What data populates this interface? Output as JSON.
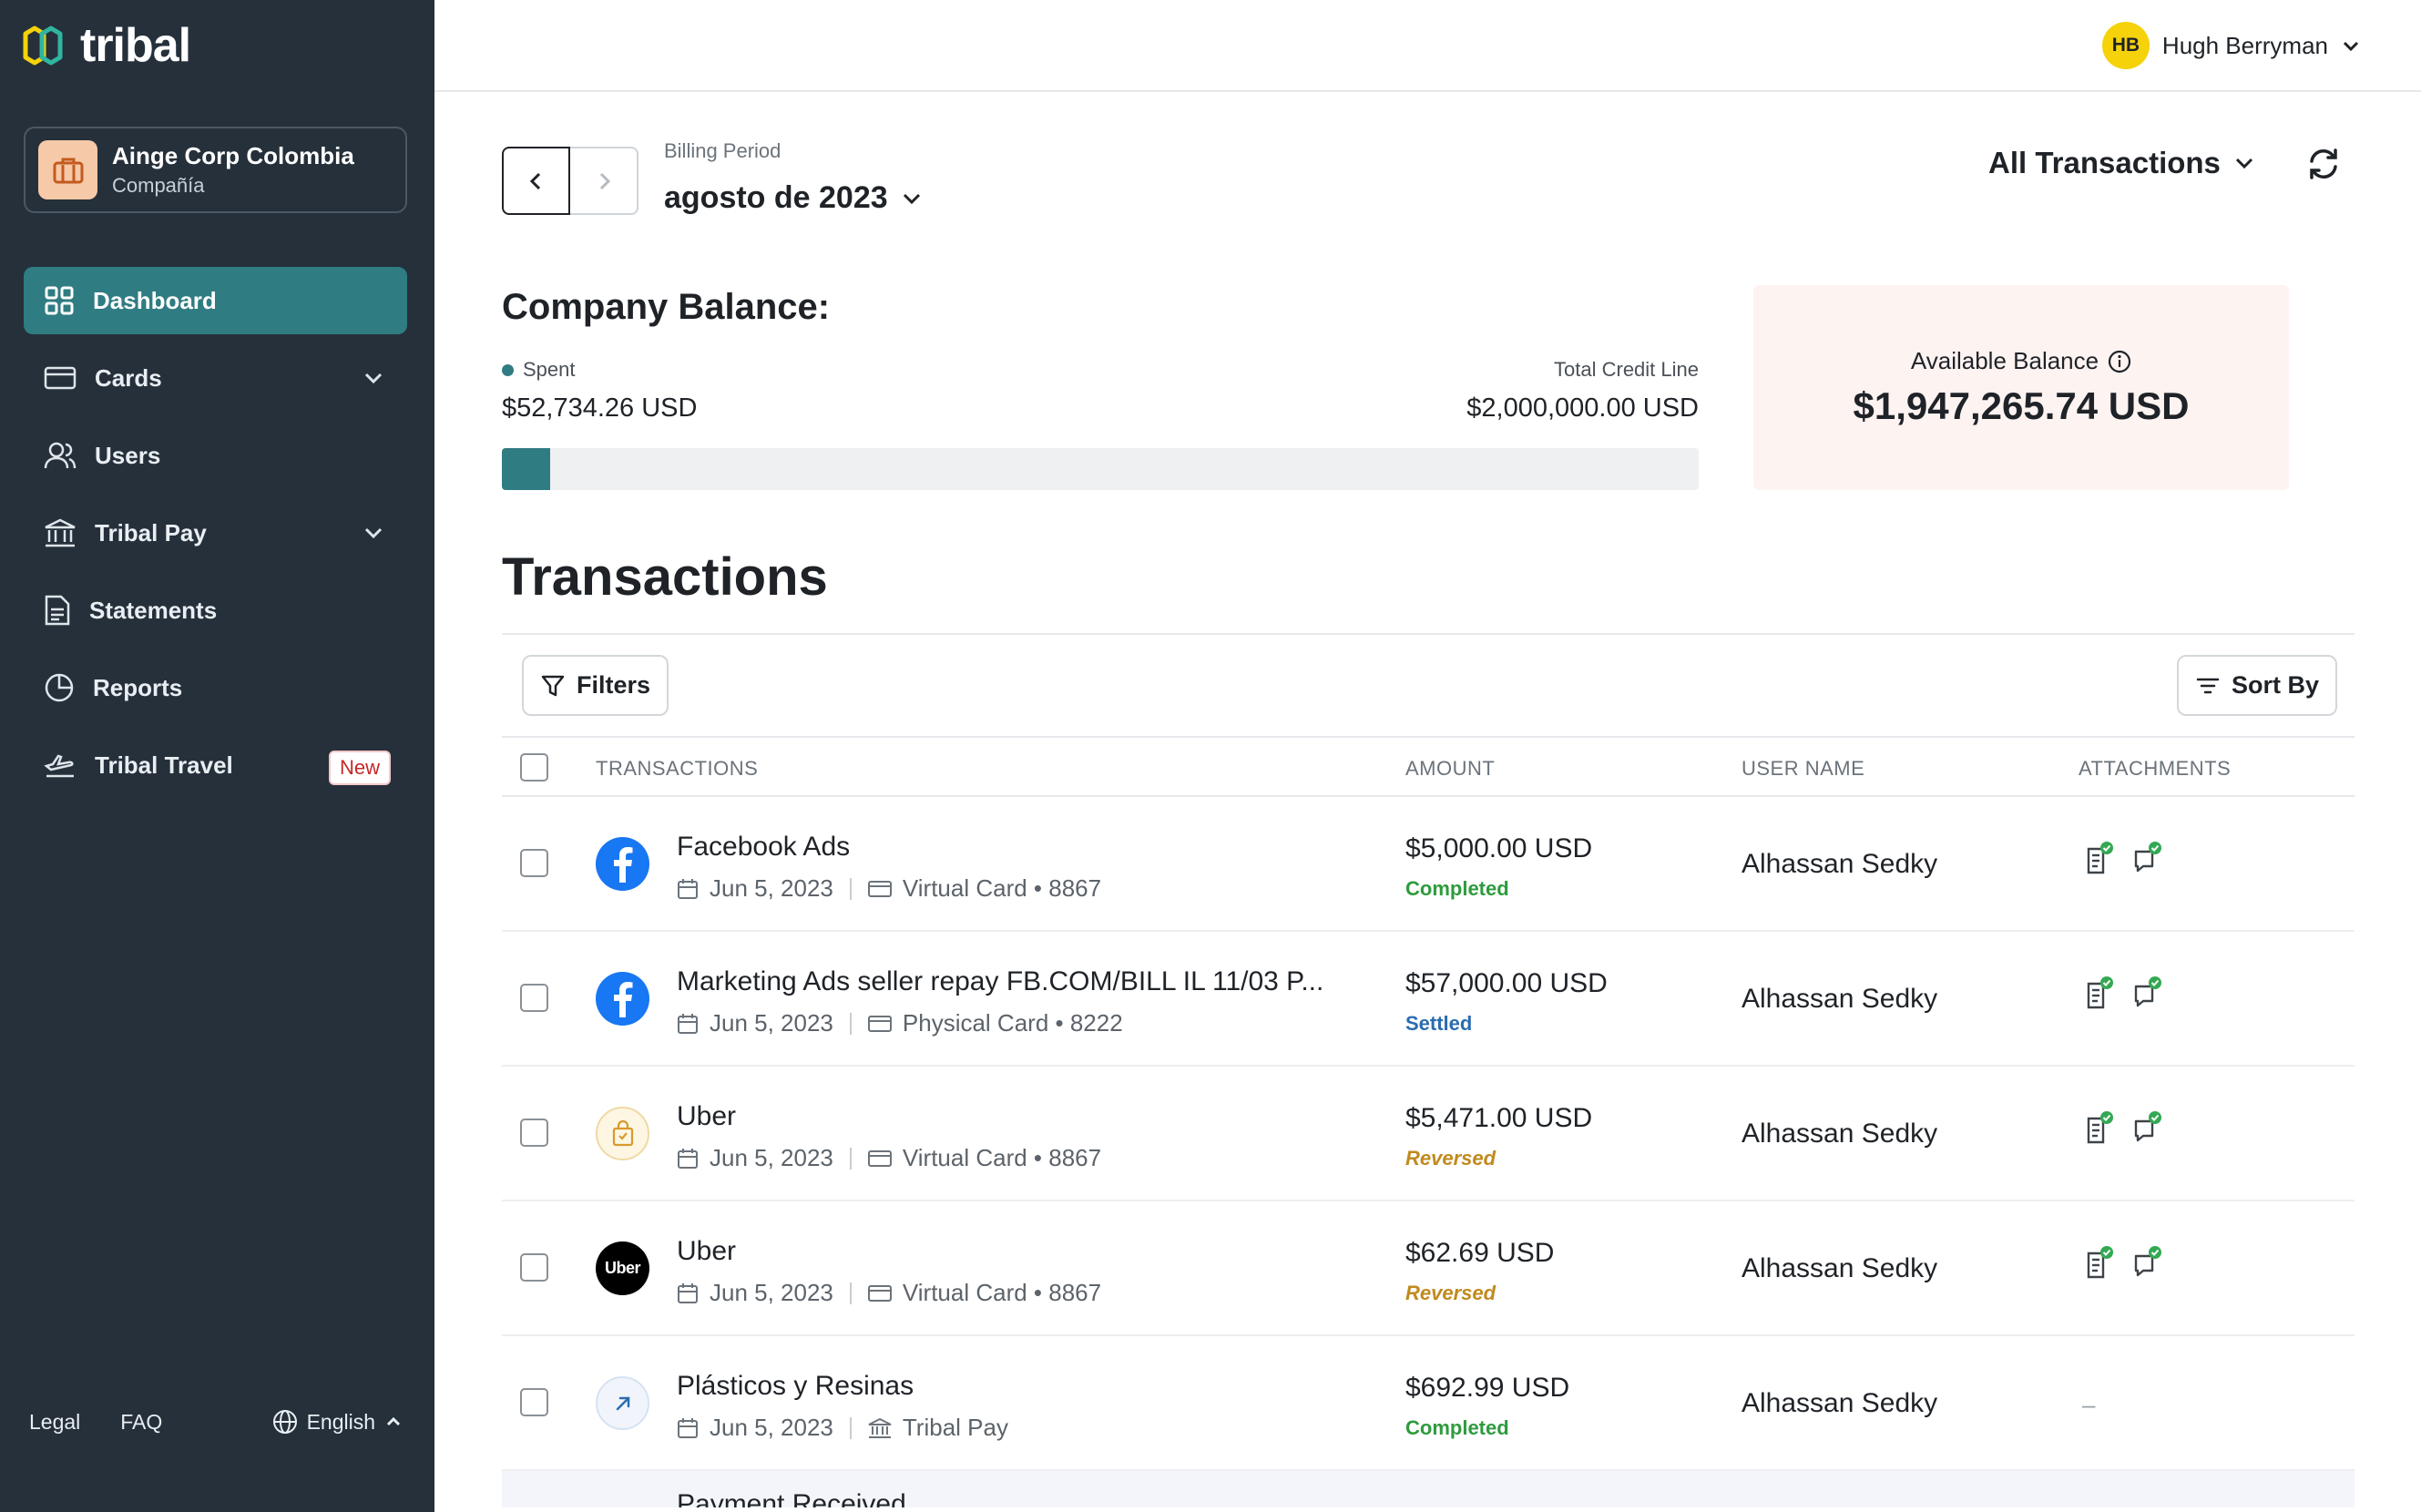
{
  "brand": {
    "name": "tribal"
  },
  "company": {
    "name": "Ainge Corp Colombia",
    "type": "Compañía"
  },
  "nav": [
    {
      "label": "Dashboard",
      "icon": "grid-icon"
    },
    {
      "label": "Cards",
      "icon": "card-icon"
    },
    {
      "label": "Users",
      "icon": "users-icon"
    },
    {
      "label": "Tribal Pay",
      "icon": "bank-icon"
    },
    {
      "label": "Statements",
      "icon": "document-icon"
    },
    {
      "label": "Reports",
      "icon": "pie-chart-icon"
    },
    {
      "label": "Tribal Travel",
      "icon": "plane-icon",
      "badge": "New"
    }
  ],
  "footer": {
    "legal": "Legal",
    "faq": "FAQ",
    "language": "English"
  },
  "user": {
    "initials": "HB",
    "name": "Hugh Berryman"
  },
  "billing": {
    "label": "Billing Period",
    "value": "agosto de 2023"
  },
  "view_filter": "All Transactions",
  "balance": {
    "title": "Company Balance:",
    "spent_label": "Spent",
    "spent_value": "$52,734.26 USD",
    "credit_label": "Total Credit Line",
    "credit_value": "$2,000,000.00 USD",
    "spent_fraction": 0.0264,
    "available_label": "Available Balance",
    "available_value": "$1,947,265.74 USD"
  },
  "transactions": {
    "title": "Transactions",
    "filters_label": "Filters",
    "sort_label": "Sort By",
    "columns": [
      "TRANSACTIONS",
      "AMOUNT",
      "USER NAME",
      "ATTACHMENTS"
    ],
    "rows": [
      {
        "merchant": "Facebook Ads",
        "date": "Jun 5, 2023",
        "method": "Virtual Card • 8867",
        "amount": "$5,000.00 USD",
        "status": "Completed",
        "user": "Alhassan Sedky"
      },
      {
        "merchant": "Marketing Ads seller repay FB.COM/BILL IL 11/03 P...",
        "date": "Jun 5, 2023",
        "method": "Physical Card • 8222",
        "amount": "$57,000.00 USD",
        "status": "Settled",
        "user": "Alhassan Sedky"
      },
      {
        "merchant": "Uber",
        "date": "Jun 5, 2023",
        "method": "Virtual Card • 8867",
        "amount": "$5,471.00 USD",
        "status": "Reversed",
        "user": "Alhassan Sedky"
      },
      {
        "merchant": "Uber",
        "date": "Jun 5, 2023",
        "method": "Virtual Card • 8867",
        "amount": "$62.69 USD",
        "status": "Reversed",
        "user": "Alhassan Sedky"
      },
      {
        "merchant": "Plásticos y Resinas",
        "date": "Jun 5, 2023",
        "method": "Tribal Pay",
        "amount": "$692.99 USD",
        "status": "Completed",
        "user": "Alhassan Sedky",
        "attachments_empty": "–"
      },
      {
        "merchant": "Payment Received"
      }
    ]
  },
  "colors": {
    "sidebar": "#25303b",
    "accent": "#2f7c82",
    "completed": "#2e9b3d",
    "settled": "#2b6cb0",
    "reversed": "#c08a1d",
    "avatar": "#f5d20a"
  },
  "uber_logo_text": "Uber"
}
